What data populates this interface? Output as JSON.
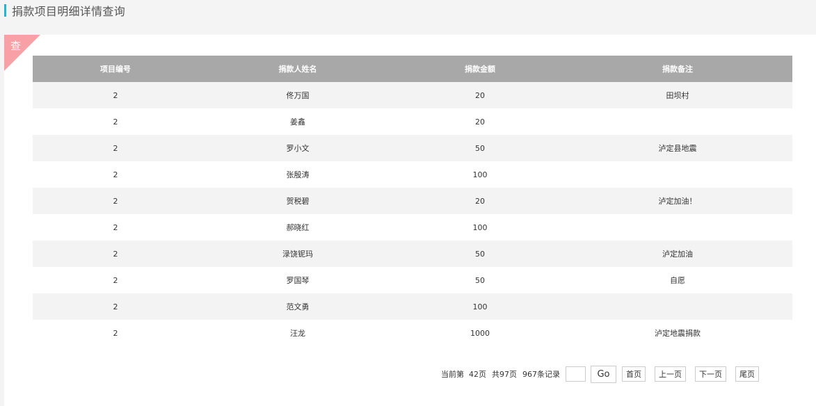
{
  "header": {
    "title": "捐款项目明细详情查询"
  },
  "corner": {
    "label": "查"
  },
  "table": {
    "columns": [
      "项目编号",
      "捐款人姓名",
      "捐款金额",
      "捐款备注"
    ],
    "rows": [
      [
        "2",
        "佟万国",
        "20",
        "田坝村"
      ],
      [
        "2",
        "姜鑫",
        "20",
        ""
      ],
      [
        "2",
        "罗小文",
        "50",
        "泸定县地震"
      ],
      [
        "2",
        "张殷涛",
        "100",
        ""
      ],
      [
        "2",
        "贺税碧",
        "20",
        "泸定加油！"
      ],
      [
        "2",
        "郝晓红",
        "100",
        ""
      ],
      [
        "2",
        "渌饶铌玛",
        "50",
        "泸定加油"
      ],
      [
        "2",
        "罗国琴",
        "50",
        "自愿"
      ],
      [
        "2",
        "范文勇",
        "100",
        ""
      ],
      [
        "2",
        "汪龙",
        "1000",
        "泸定地震捐款"
      ]
    ]
  },
  "pager": {
    "current_page_text": "当前第  42页",
    "total_pages_text": "共97页",
    "total_records_text": "967条记录",
    "page_input_value": "",
    "go_label": "Go",
    "first_label": "首页",
    "prev_label": "上一页",
    "next_label": "下一页",
    "last_label": "尾页"
  }
}
